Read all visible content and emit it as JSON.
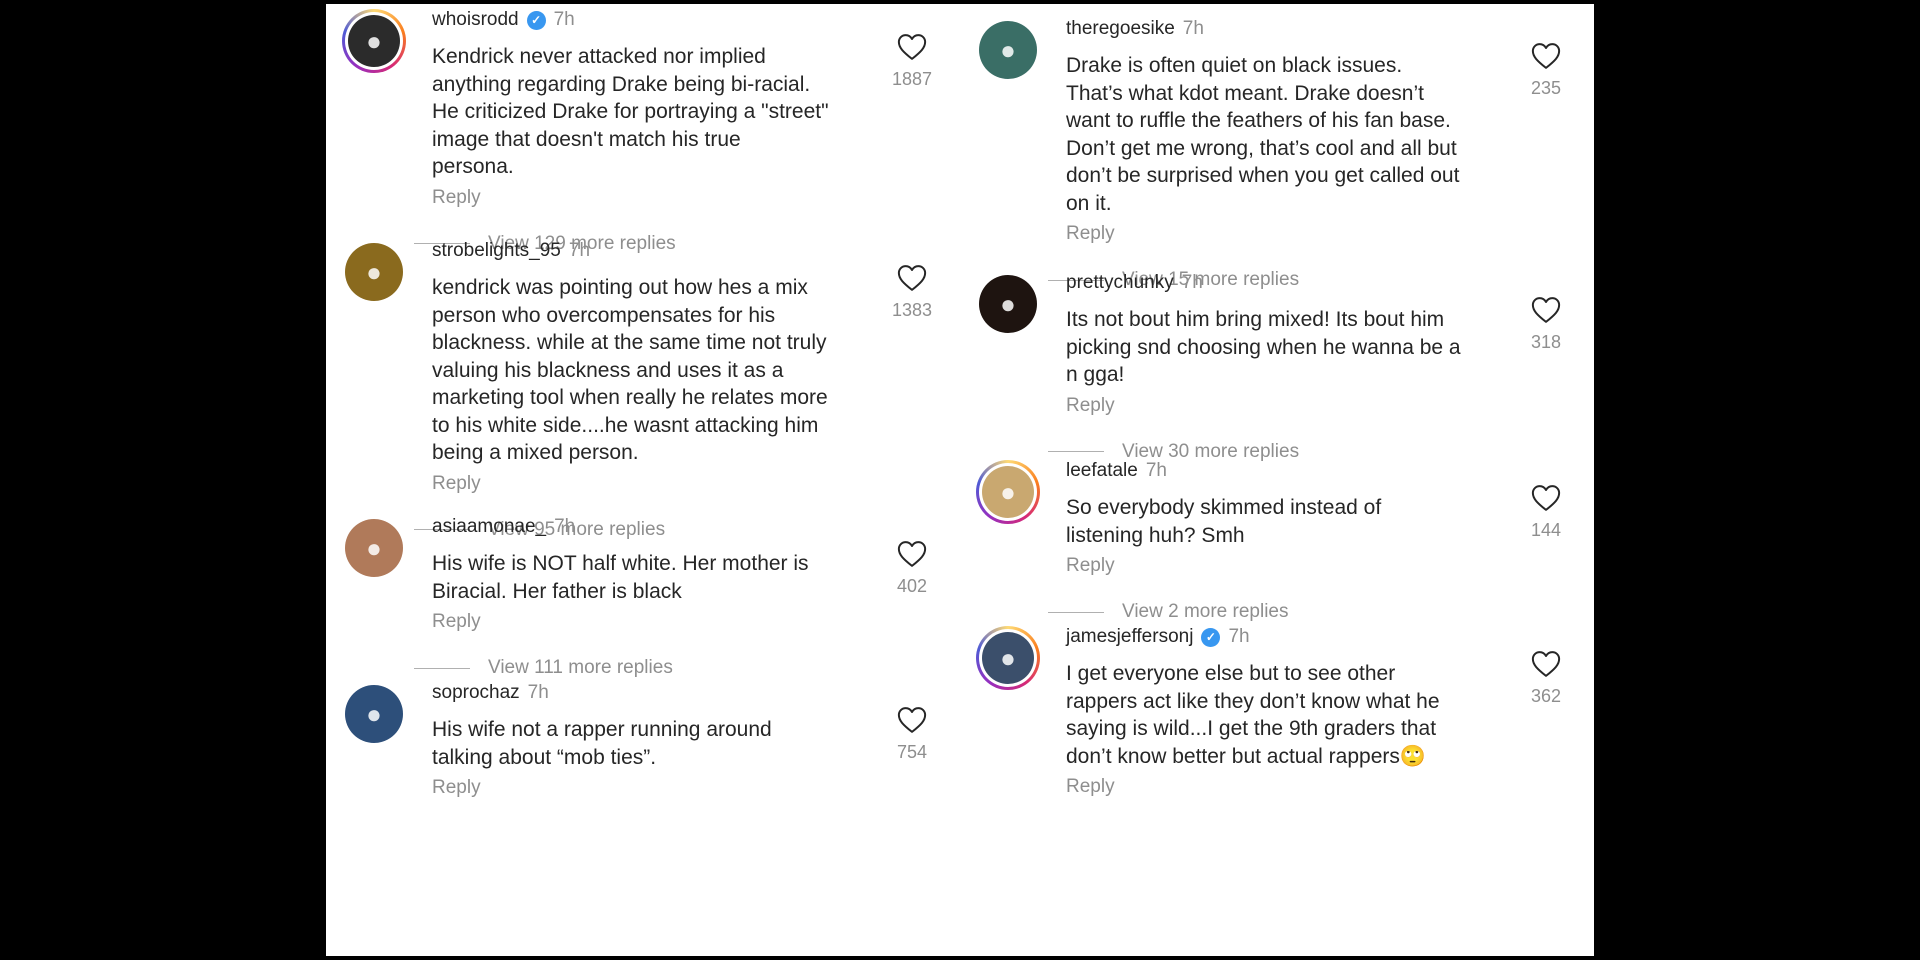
{
  "left_column": [
    {
      "username": "whoisrodd",
      "verified": true,
      "time": "7h",
      "lines": [
        "Kendrick never attacked nor implied",
        "anything regarding Drake being bi-racial.",
        "He criticized Drake for portraying a \"street\"",
        "image that doesn't match his true",
        "persona."
      ],
      "likes": "1887",
      "reply": "Reply",
      "view_replies": "View 129 more replies",
      "avatar_color": "#2b2b2b",
      "story_ring": true
    },
    {
      "username": "strobelights_95",
      "verified": false,
      "time": "7h",
      "lines": [
        "kendrick was pointing out how hes a mix",
        "person who overcompensates for his",
        "blackness. while at the same time not truly",
        "valuing his blackness and uses it as a",
        "marketing tool when really he relates more",
        "to his white side....he wasnt attacking him",
        "being a mixed person."
      ],
      "likes": "1383",
      "reply": "Reply",
      "view_replies": "View 95 more replies",
      "avatar_color": "#8a6a1e",
      "story_ring": false
    },
    {
      "username": "asiaamonae_",
      "verified": false,
      "time": "7h",
      "lines": [
        "His wife is NOT half white. Her mother is",
        "Biracial. Her father is black"
      ],
      "likes": "402",
      "reply": "Reply",
      "view_replies": "View 111 more replies",
      "avatar_color": "#b07a5a",
      "story_ring": false
    },
    {
      "username": "soprochaz",
      "verified": false,
      "time": "7h",
      "lines": [
        "His wife not a rapper running around",
        "talking about “mob ties”."
      ],
      "likes": "754",
      "reply": "Reply",
      "view_replies": "",
      "avatar_color": "#2d4f7a",
      "story_ring": false
    }
  ],
  "right_column": [
    {
      "username": "theregoesike",
      "verified": false,
      "time": "7h",
      "lines": [
        "Drake is often quiet on black issues.",
        "That’s what kdot meant. Drake doesn’t",
        "want to ruffle the feathers of his fan base.",
        "Don’t get me wrong, that’s cool and all but",
        "don’t be surprised when you get called out",
        "on it."
      ],
      "likes": "235",
      "reply": "Reply",
      "view_replies": "View 15 more replies",
      "avatar_color": "#3a6e66",
      "story_ring": false
    },
    {
      "username": "prettychunky",
      "verified": false,
      "time": "7h",
      "lines": [
        "Its not bout him bring mixed! Its bout him",
        "picking snd choosing when he wanna be a",
        "n gga!"
      ],
      "likes": "318",
      "reply": "Reply",
      "view_replies": "View 30 more replies",
      "avatar_color": "#1e1410",
      "story_ring": false
    },
    {
      "username": "leefatale",
      "verified": false,
      "time": "7h",
      "lines": [
        "So everybody skimmed instead of",
        "listening huh? Smh"
      ],
      "likes": "144",
      "reply": "Reply",
      "view_replies": "View 2 more replies",
      "avatar_color": "#c9a870",
      "story_ring": true
    },
    {
      "username": "jamesjeffersonj",
      "verified": true,
      "time": "7h",
      "lines": [
        "I get everyone else but to see other",
        "rappers act like they don’t know what he",
        "saying is wild...I get the 9th graders that",
        "don’t know better but actual rappers🙄"
      ],
      "likes": "362",
      "reply": "Reply",
      "view_replies": "",
      "avatar_color": "#3b4f6b",
      "story_ring": true
    }
  ],
  "icons": {
    "like": "heart-outline-icon",
    "verified": "verified-badge-icon"
  },
  "colors": {
    "verified_blue": "#3897f0",
    "text": "#262626",
    "muted": "#8e8e8e"
  }
}
